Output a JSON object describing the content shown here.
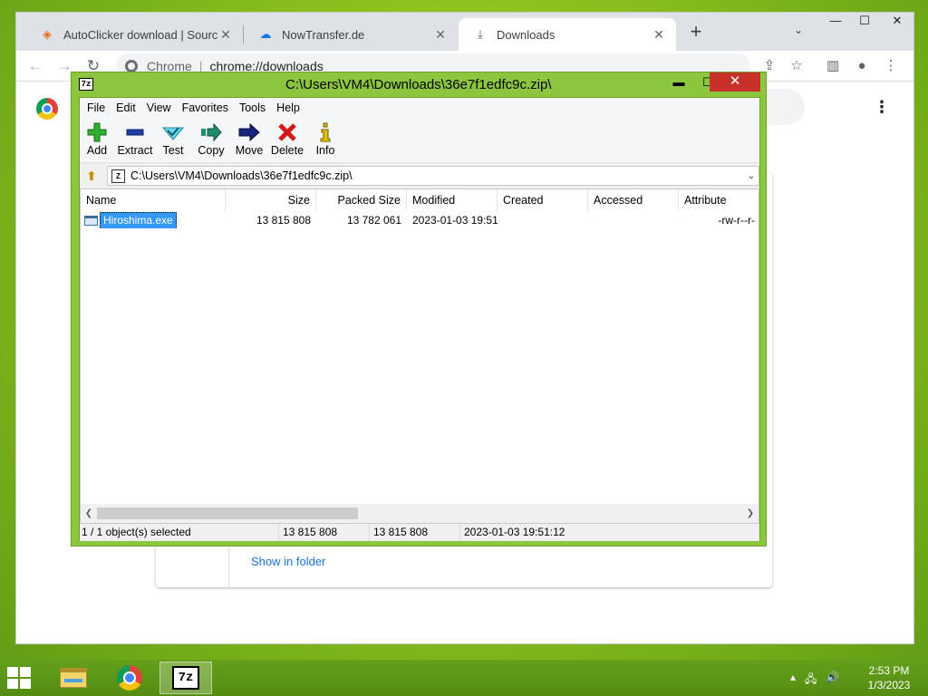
{
  "chrome": {
    "tabs": [
      {
        "title": "AutoClicker download | SourceFc",
        "icon": "sourceforge-icon",
        "close": "✕"
      },
      {
        "title": "NowTransfer.de",
        "icon": "cloud-icon",
        "close": "✕"
      },
      {
        "title": "Downloads",
        "icon": "download-icon",
        "close": "✕"
      }
    ],
    "new_tab": "+",
    "omnibox": {
      "label": "Chrome",
      "separator": "|",
      "url": "chrome://downloads"
    },
    "downloads_page": {
      "show_in_folder": "Show in folder"
    }
  },
  "sevenzip": {
    "title": "C:\\Users\\VM4\\Downloads\\36e7f1edfc9c.zip\\",
    "menu": [
      "File",
      "Edit",
      "View",
      "Favorites",
      "Tools",
      "Help"
    ],
    "toolbar": [
      {
        "label": "Add",
        "icon": "plus-icon",
        "color": "#2fb12f"
      },
      {
        "label": "Extract",
        "icon": "minus-icon",
        "color": "#1c3fa8"
      },
      {
        "label": "Test",
        "icon": "check-icon",
        "color": "#2aa9c9"
      },
      {
        "label": "Copy",
        "icon": "copy-arrow-icon",
        "color": "#1f8c6e"
      },
      {
        "label": "Move",
        "icon": "move-arrow-icon",
        "color": "#15237a"
      },
      {
        "label": "Delete",
        "icon": "delete-x-icon",
        "color": "#d11a1a"
      },
      {
        "label": "Info",
        "icon": "info-icon",
        "color": "#e1c200"
      }
    ],
    "path": "C:\\Users\\VM4\\Downloads\\36e7f1edfc9c.zip\\",
    "columns": [
      "Name",
      "Size",
      "Packed Size",
      "Modified",
      "Created",
      "Accessed",
      "Attribute"
    ],
    "rows": [
      {
        "name": "Hiroshima.exe",
        "size": "13 815 808",
        "packed": "13 782 061",
        "modified": "2023-01-03 19:51",
        "created": "",
        "accessed": "",
        "attributes": "-rw-r--r-"
      }
    ],
    "status": {
      "selection": "1 / 1 object(s) selected",
      "size": "13 815 808",
      "packed": "13 815 808",
      "modified": "2023-01-03 19:51:12"
    },
    "accent_color": "#8cc63f",
    "close_color": "#c7312a"
  },
  "taskbar": {
    "apps": [
      "file-explorer-icon",
      "chrome-icon",
      "7zip-icon"
    ],
    "clock_time": "2:53 PM",
    "clock_date": "1/3/2023",
    "sevenzip_glyph": "7z"
  }
}
